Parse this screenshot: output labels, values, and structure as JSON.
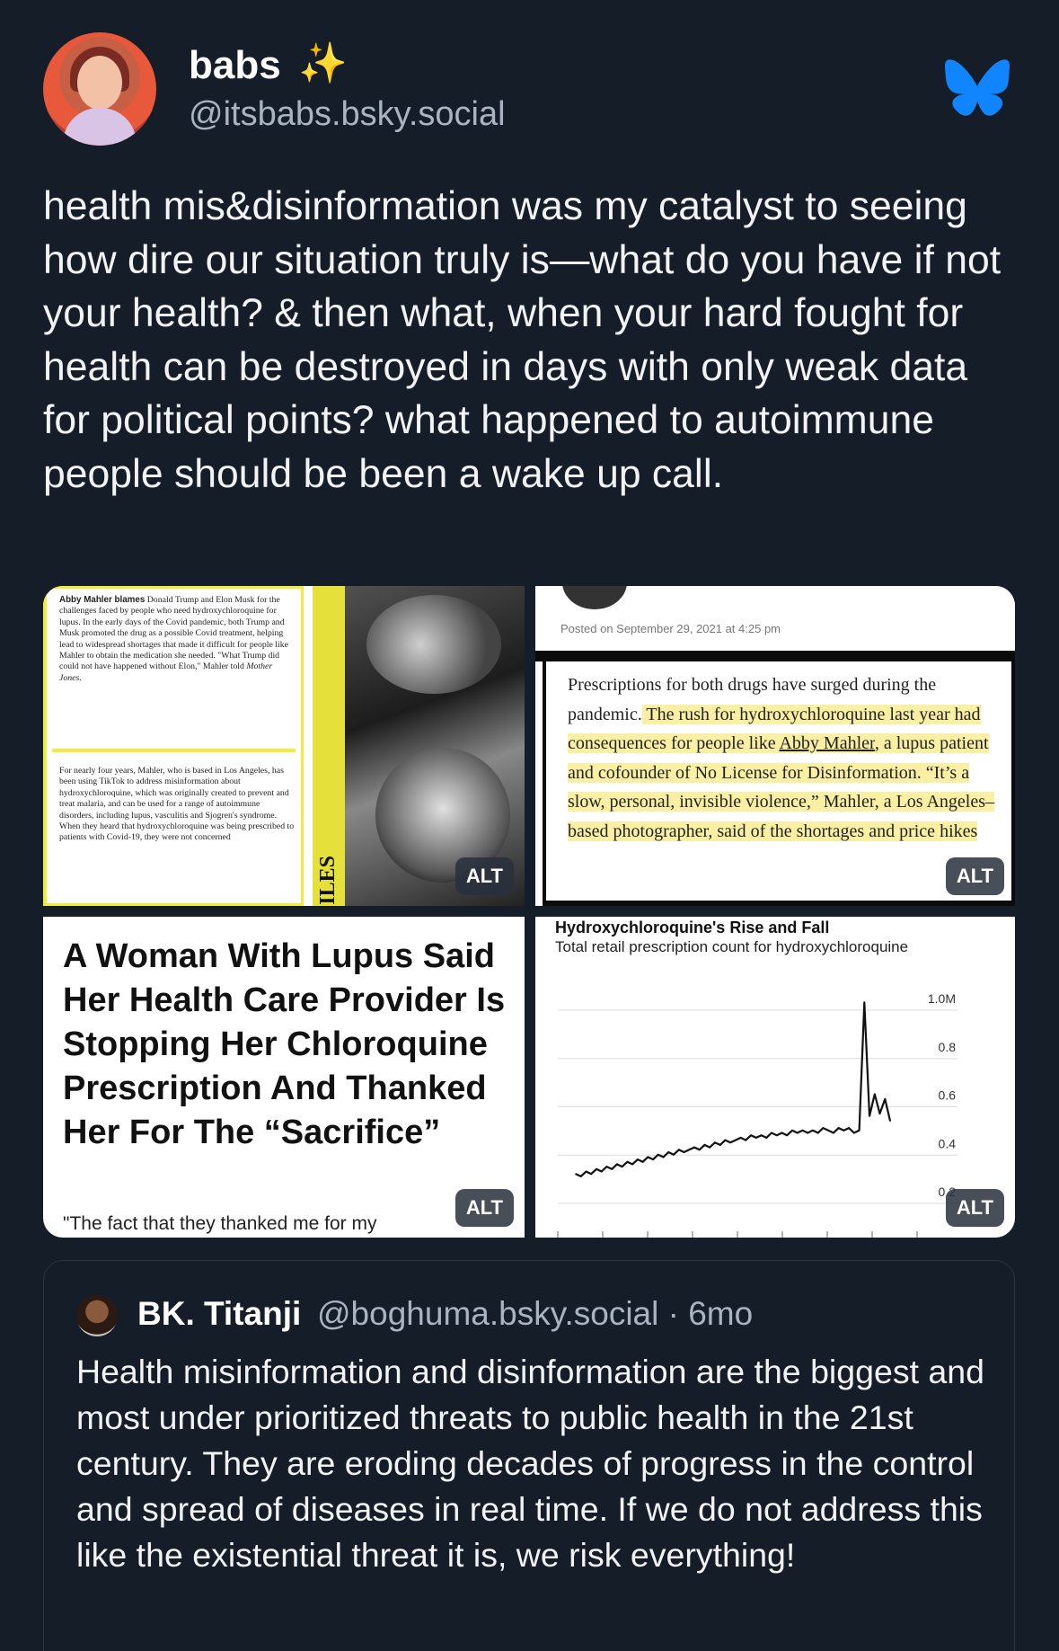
{
  "author": {
    "display_name": "babs",
    "emoji": "✨",
    "handle": "@itsbabs.bsky.social"
  },
  "post": {
    "text": "health mis&disinformation was my catalyst to seeing how dire our situation truly is—what do you have if not your health? & then what, when your hard fought for health can be destroyed in days with only weak data for political points? what happened to autoimmune people should be been a wake up call."
  },
  "images": {
    "alt_label": "ALT",
    "image1": {
      "para1_bold": "Abby Mahler blames",
      "para1": "Donald Trump and Elon Musk for the challenges faced by people who need hydroxychloroquine for lupus. In the early days of the Covid pandemic, both Trump and Musk promoted the drug as a possible Covid treatment, helping lead to widespread shortages that made it difficult for people like Mahler to obtain the medication she needed. \"What Trump did could not have happened without Elon,\" Mahler told",
      "para1_source": "Mother Jones.",
      "para2": "For nearly four years, Mahler, who is based in Los Angeles, has been using TikTok to address misinformation about hydroxychloroquine, which was originally created to prevent and treat malaria, and can be used for a range of autoimmune disorders, including lupus, vasculitis and Sjogren's syndrome. When they heard that hydroxychloroquine was being prescribed to patients with Covid-19, they were not concerned",
      "tape_text": "ILES"
    },
    "image2": {
      "posted": "Posted on September 29, 2021 at 4:25 pm",
      "text_plain": "Prescriptions for both drugs have surged during the pandemic.",
      "text_highlight1": " The rush for hydroxychloroquine last year had consequences for people like ",
      "text_link": "Abby Mahler",
      "text_highlight2": ", a lupus patient and cofounder of No License for Disinformation. “It’s a slow, personal, invisible violence,” Mahler, a Los Angeles–based photographer, said of the shortages and price hikes"
    },
    "image3": {
      "headline": "A Woman With Lupus Said Her Health Care Provider Is Stopping Her Chloroquine Prescription And Thanked Her For The “Sacrifice”",
      "quote": "\"The fact that they thanked me for my"
    },
    "image4": {
      "title": "Hydroxychloroquine's Rise and Fall",
      "subtitle": "Total retail prescription count for hydroxychloroquine"
    }
  },
  "chart_data": {
    "type": "line",
    "title": "Hydroxychloroquine's Rise and Fall",
    "subtitle": "Total retail prescription count for hydroxychloroquine",
    "y_ticks": [
      "1.0M",
      "0.8",
      "0.6",
      "0.4",
      "0.2"
    ],
    "ylim": [
      0.2,
      1.0
    ],
    "series": [
      {
        "values": [
          0.27,
          0.26,
          0.28,
          0.27,
          0.29,
          0.28,
          0.3,
          0.29,
          0.31,
          0.3,
          0.32,
          0.31,
          0.33,
          0.32,
          0.34,
          0.33,
          0.35,
          0.34,
          0.36,
          0.35,
          0.37,
          0.36,
          0.37,
          0.38,
          0.37,
          0.39,
          0.38,
          0.4,
          0.39,
          0.41,
          0.4,
          0.41,
          0.42,
          0.41,
          0.43,
          0.42,
          0.43,
          0.42,
          0.44,
          0.43,
          0.44,
          0.43,
          0.45,
          0.44,
          0.45,
          0.44,
          0.45,
          0.44,
          0.46,
          0.45,
          0.44,
          0.46,
          0.45,
          0.46,
          0.44,
          0.45,
          0.98,
          0.51,
          0.6,
          0.52,
          0.58,
          0.49
        ]
      }
    ]
  },
  "quote_post": {
    "name": "BK. Titanji",
    "handle_time": "@boghuma.bsky.social · 6mo",
    "text": "Health misinformation and disinformation are the biggest and most under prioritized threats to public health in the 21st century. They are eroding decades of progress in the control and spread of diseases in real time. If we do not address this like the existential threat it is, we risk everything!"
  },
  "colors": {
    "background": "#151d28",
    "bluesky_blue": "#1185fe",
    "highlight": "#fbefa4"
  }
}
